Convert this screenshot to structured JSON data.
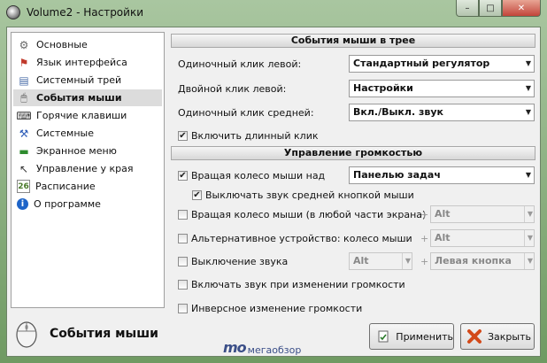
{
  "window": {
    "title": "Volume2 - Настройки",
    "close_glyph": "✕",
    "maximize_glyph": "□",
    "minimize_glyph": "–"
  },
  "sidebar": {
    "items": [
      {
        "label": "Основные",
        "icon": "settings-icon",
        "glyph": "⚙",
        "color": "#666666",
        "selected": false
      },
      {
        "label": "Язык интерфейса",
        "icon": "flag-icon",
        "glyph": "⚑",
        "color": "#c0392b",
        "selected": false
      },
      {
        "label": "Системный трей",
        "icon": "tray-icon",
        "glyph": "▤",
        "color": "#4b6ea9",
        "selected": false
      },
      {
        "label": "События мыши",
        "icon": "mouse-icon",
        "glyph": "🖱",
        "color": "#555555",
        "selected": true
      },
      {
        "label": "Горячие клавиши",
        "icon": "keyboard-icon",
        "glyph": "⌨",
        "color": "#333333",
        "selected": false
      },
      {
        "label": "Системные",
        "icon": "tools-icon",
        "glyph": "⚒",
        "color": "#2e5db8",
        "selected": false
      },
      {
        "label": "Экранное меню",
        "icon": "screen-menu-icon",
        "glyph": "▬",
        "color": "#2e8b2e",
        "selected": false
      },
      {
        "label": "Управление у края",
        "icon": "edge-cursor-icon",
        "glyph": "↖",
        "color": "#333333",
        "selected": false
      },
      {
        "label": "Расписание",
        "icon": "calendar-icon",
        "glyph": "26",
        "color": "#4a7a2a",
        "selected": false
      },
      {
        "label": "О программе",
        "icon": "info-icon",
        "glyph": "i",
        "color": "#1e64c8",
        "selected": false
      }
    ]
  },
  "section_tray": {
    "title": "События мыши в трее",
    "left_click_label": "Одиночный клик левой:",
    "left_click_value": "Стандартный регулятор",
    "double_click_label": "Двойной клик левой:",
    "double_click_value": "Настройки",
    "middle_click_label": "Одиночный клик средней:",
    "middle_click_value": "Вкл./Выкл. звук",
    "long_click_label": "Включить длинный клик",
    "long_click_checked": true
  },
  "section_volume": {
    "title": "Управление громкостью",
    "wheel_over_label": "Вращая колесо мыши над",
    "wheel_over_checked": true,
    "wheel_over_value": "Панелью задач",
    "mute_middle_label": "Выключать звук средней кнопкой мыши",
    "mute_middle_checked": true,
    "wheel_anywhere_label": "Вращая колесо мыши (в любой части экрана)",
    "wheel_anywhere_checked": false,
    "wheel_anywhere_mod": "Alt",
    "alt_device_label": "Альтернативное устройство: колесо мыши",
    "alt_device_checked": false,
    "alt_device_mod": "Alt",
    "mute_label": "Выключение звука",
    "mute_checked": false,
    "mute_mod": "Alt",
    "mute_button": "Левая кнопка",
    "sound_on_change_label": "Включать звук при изменении громкости",
    "sound_on_change_checked": false,
    "inverse_label": "Инверсное изменение громкости",
    "inverse_checked": false,
    "plus_sign": "+"
  },
  "footer": {
    "title": "События мыши",
    "apply_label": "Применить",
    "close_label": "Закрыть"
  },
  "watermark": {
    "big": "mo",
    "text": "мегаобзор"
  }
}
